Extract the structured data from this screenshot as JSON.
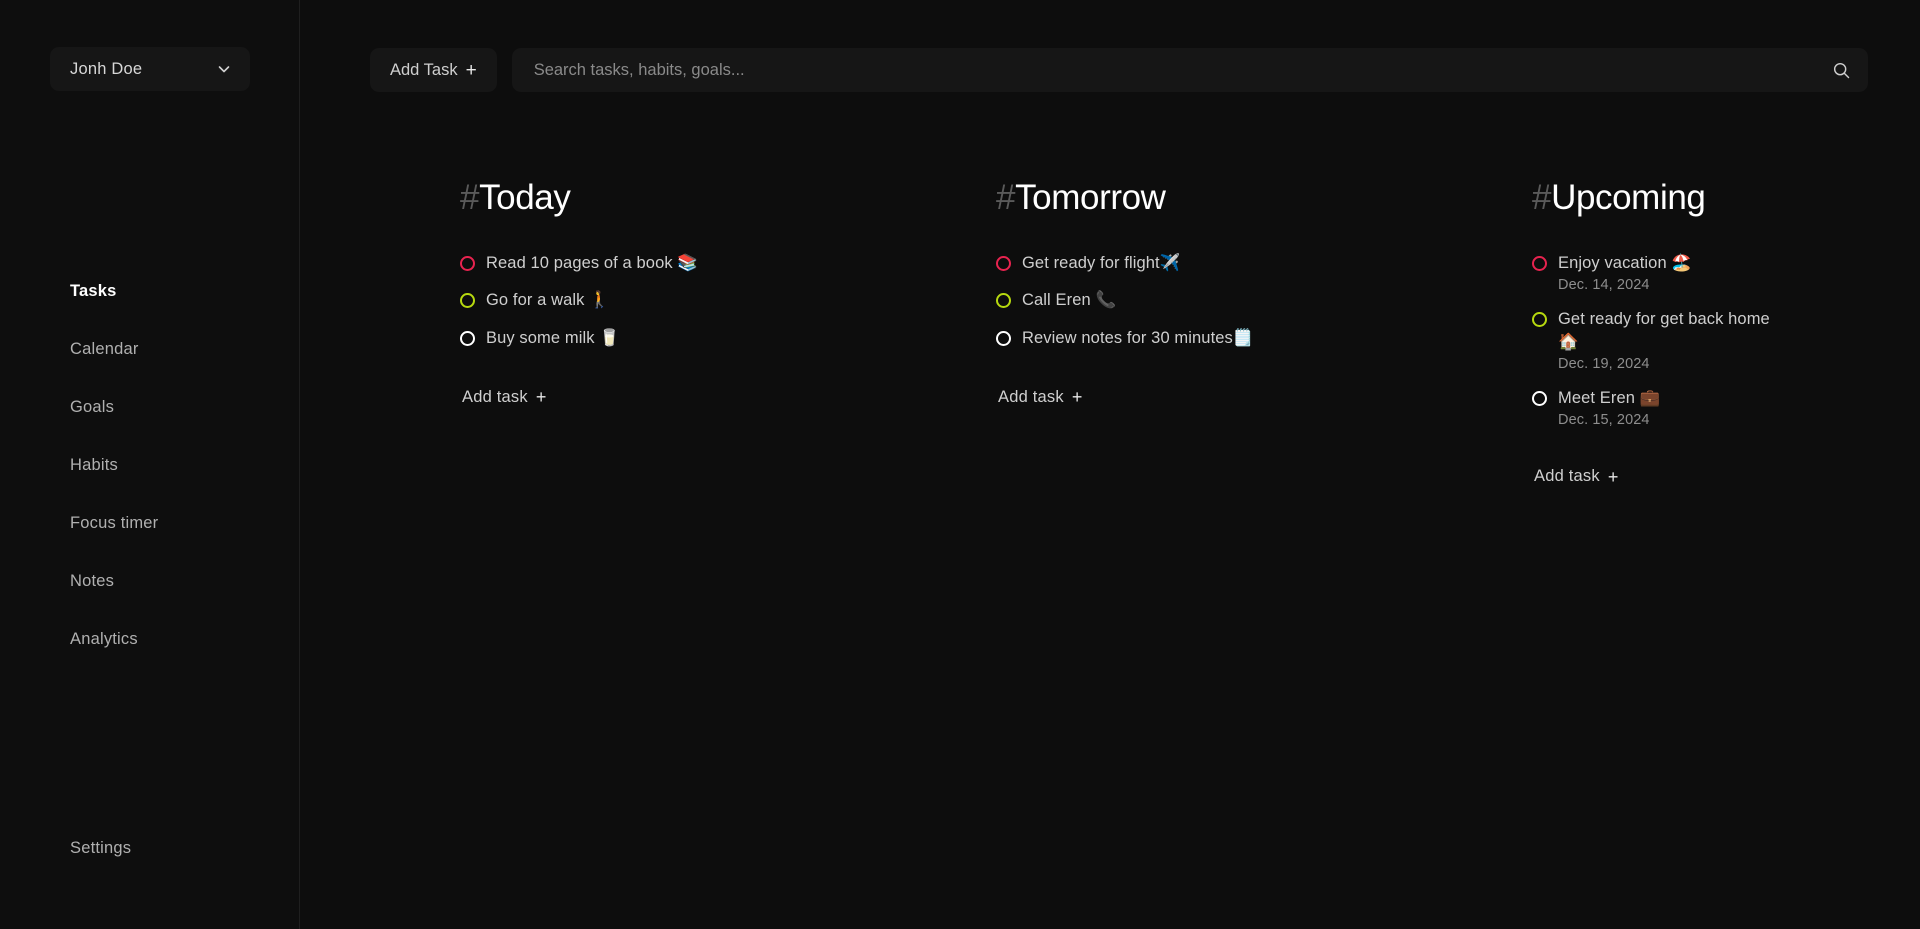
{
  "theme": {
    "background": "#0d0d0d",
    "sidebar_background": "#0e0e0e",
    "panel_background": "#161616",
    "text_primary": "#ffffff",
    "text_secondary": "#cfcfcf",
    "text_muted": "#8e8e8e",
    "accent_red": "#e8234f",
    "accent_green": "#b7d90f",
    "accent_white": "#ffffff"
  },
  "sidebar": {
    "user": {
      "name": "Jonh Doe",
      "chevron_icon": "chevron-down-icon"
    },
    "items": [
      {
        "label": "Tasks",
        "active": true
      },
      {
        "label": "Calendar",
        "active": false
      },
      {
        "label": "Goals",
        "active": false
      },
      {
        "label": "Habits",
        "active": false
      },
      {
        "label": "Focus timer",
        "active": false
      },
      {
        "label": "Notes",
        "active": false
      },
      {
        "label": "Analytics",
        "active": false
      }
    ],
    "settings": {
      "label": "Settings"
    }
  },
  "toolbar": {
    "add_task_label": "Add Task",
    "add_task_plus": "+",
    "search_placeholder": "Search tasks, habits, goals...",
    "search_value": "",
    "search_icon": "search-icon"
  },
  "columns": [
    {
      "hash": "#",
      "title": "Today",
      "add_task_label": "Add task",
      "add_task_plus": "+",
      "tasks": [
        {
          "label": "Read 10 pages of a book 📚",
          "color": "#e8234f",
          "due": ""
        },
        {
          "label": "Go for a walk 🚶",
          "color": "#b7d90f",
          "due": ""
        },
        {
          "label": "Buy some milk 🥛",
          "color": "#ffffff",
          "due": ""
        }
      ]
    },
    {
      "hash": "#",
      "title": "Tomorrow",
      "add_task_label": "Add task",
      "add_task_plus": "+",
      "tasks": [
        {
          "label": "Get ready for flight✈️",
          "color": "#e8234f",
          "due": ""
        },
        {
          "label": "Call Eren 📞",
          "color": "#b7d90f",
          "due": ""
        },
        {
          "label": "Review notes for 30 minutes🗒️",
          "color": "#ffffff",
          "due": ""
        }
      ]
    },
    {
      "hash": "#",
      "title": "Upcoming",
      "add_task_label": "Add task",
      "add_task_plus": "+",
      "tasks": [
        {
          "label": "Enjoy vacation 🏖️",
          "color": "#e8234f",
          "due": "Dec. 14, 2024"
        },
        {
          "label": "Get ready for get back home 🏠",
          "color": "#b7d90f",
          "due": "Dec. 19, 2024"
        },
        {
          "label": "Meet Eren 💼",
          "color": "#ffffff",
          "due": "Dec. 15, 2024"
        }
      ]
    }
  ]
}
